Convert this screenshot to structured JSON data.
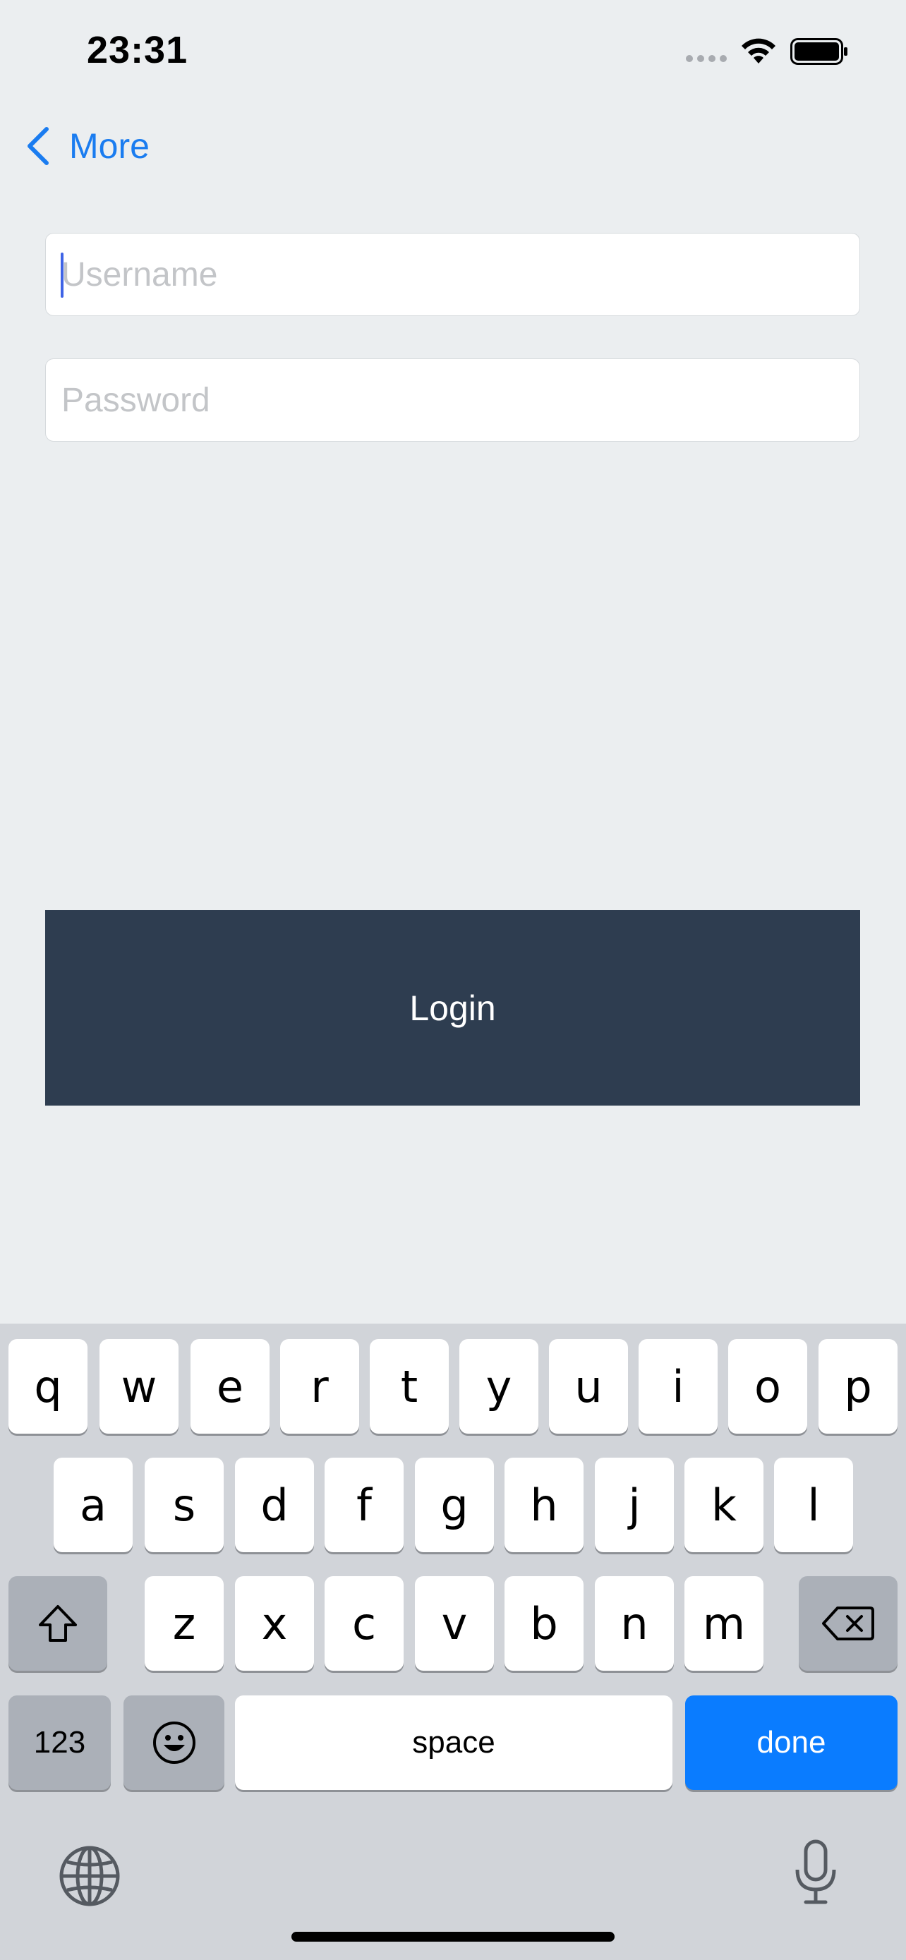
{
  "status_bar": {
    "time": "23:31"
  },
  "nav": {
    "back_label": "More"
  },
  "form": {
    "username_placeholder": "Username",
    "password_placeholder": "Password",
    "login_label": "Login"
  },
  "keyboard": {
    "row1": [
      "q",
      "w",
      "e",
      "r",
      "t",
      "y",
      "u",
      "i",
      "o",
      "p"
    ],
    "row2": [
      "a",
      "s",
      "d",
      "f",
      "g",
      "h",
      "j",
      "k",
      "l"
    ],
    "row3": [
      "z",
      "x",
      "c",
      "v",
      "b",
      "n",
      "m"
    ],
    "numbers_label": "123",
    "space_label": "space",
    "done_label": "done"
  },
  "colors": {
    "accent": "#1a7cf0",
    "button": "#2e3d50",
    "done": "#0a7cff"
  }
}
